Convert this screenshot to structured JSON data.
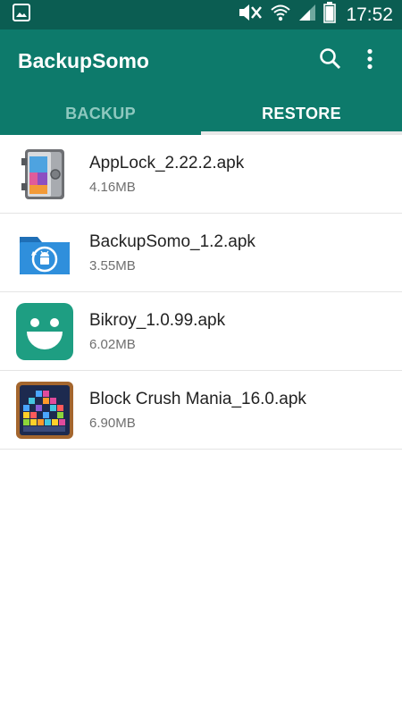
{
  "status_bar": {
    "time": "17:52",
    "icons": [
      "gallery-icon",
      "mute-icon",
      "wifi-icon",
      "signal-icon",
      "battery-icon"
    ]
  },
  "app_bar": {
    "title": "BackupSomo",
    "actions": [
      "search-icon",
      "overflow-menu-icon"
    ]
  },
  "tabs": [
    {
      "label": "BACKUP",
      "selected": false
    },
    {
      "label": "RESTORE",
      "selected": true
    }
  ],
  "colors": {
    "status_bar": "#0b5d52",
    "app_bar": "#0d7a6b",
    "tab_inactive": "#8ec8bf",
    "tab_active": "#ffffff"
  },
  "apk_list": [
    {
      "name": "AppLock_2.22.2.apk",
      "size": "4.16MB",
      "icon": "applock-safe-icon"
    },
    {
      "name": "BackupSomo_1.2.apk",
      "size": "3.55MB",
      "icon": "backupsomo-folder-icon"
    },
    {
      "name": "Bikroy_1.0.99.apk",
      "size": "6.02MB",
      "icon": "bikroy-smile-icon"
    },
    {
      "name": "Block Crush Mania_16.0.apk",
      "size": "6.90MB",
      "icon": "block-crush-mania-icon"
    }
  ]
}
